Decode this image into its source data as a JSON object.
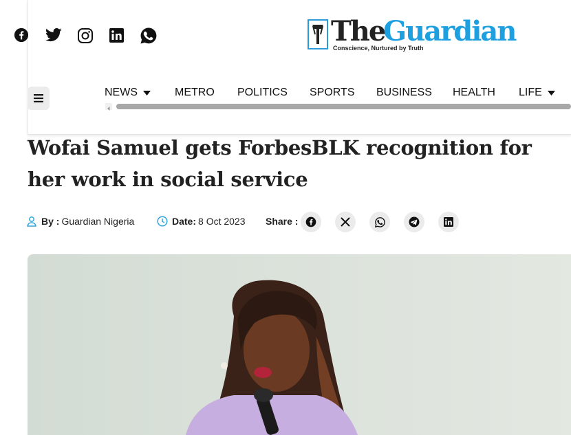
{
  "header": {
    "social_icons": [
      "facebook-icon",
      "twitter-icon",
      "instagram-icon",
      "linkedin-icon",
      "whatsapp-icon"
    ],
    "logo": {
      "the": "The",
      "guardian": "Guardian",
      "tagline": "Conscience, Nurtured by Truth"
    },
    "nav": [
      {
        "label": "NEWS",
        "dropdown": true
      },
      {
        "label": "METRO",
        "dropdown": false
      },
      {
        "label": "POLITICS",
        "dropdown": false
      },
      {
        "label": "SPORTS",
        "dropdown": false
      },
      {
        "label": "BUSINESS",
        "dropdown": false
      },
      {
        "label": "HEALTH",
        "dropdown": false
      },
      {
        "label": "LIFE",
        "dropdown": true
      }
    ]
  },
  "article": {
    "title": "Wofai Samuel gets ForbesBLK recognition for her work in social service",
    "by_label": "By :",
    "author": "Guardian Nigeria",
    "date_label": "Date:",
    "date": "8 Oct 2023",
    "share_label": "Share :",
    "share_icons": [
      "facebook-icon",
      "x-icon",
      "whatsapp-icon",
      "telegram-icon",
      "linkedin-icon"
    ]
  },
  "colors": {
    "accent": "#1ea0e0",
    "meta_icon": "#2fa6d9",
    "hero_bg": "#dde3dc"
  }
}
